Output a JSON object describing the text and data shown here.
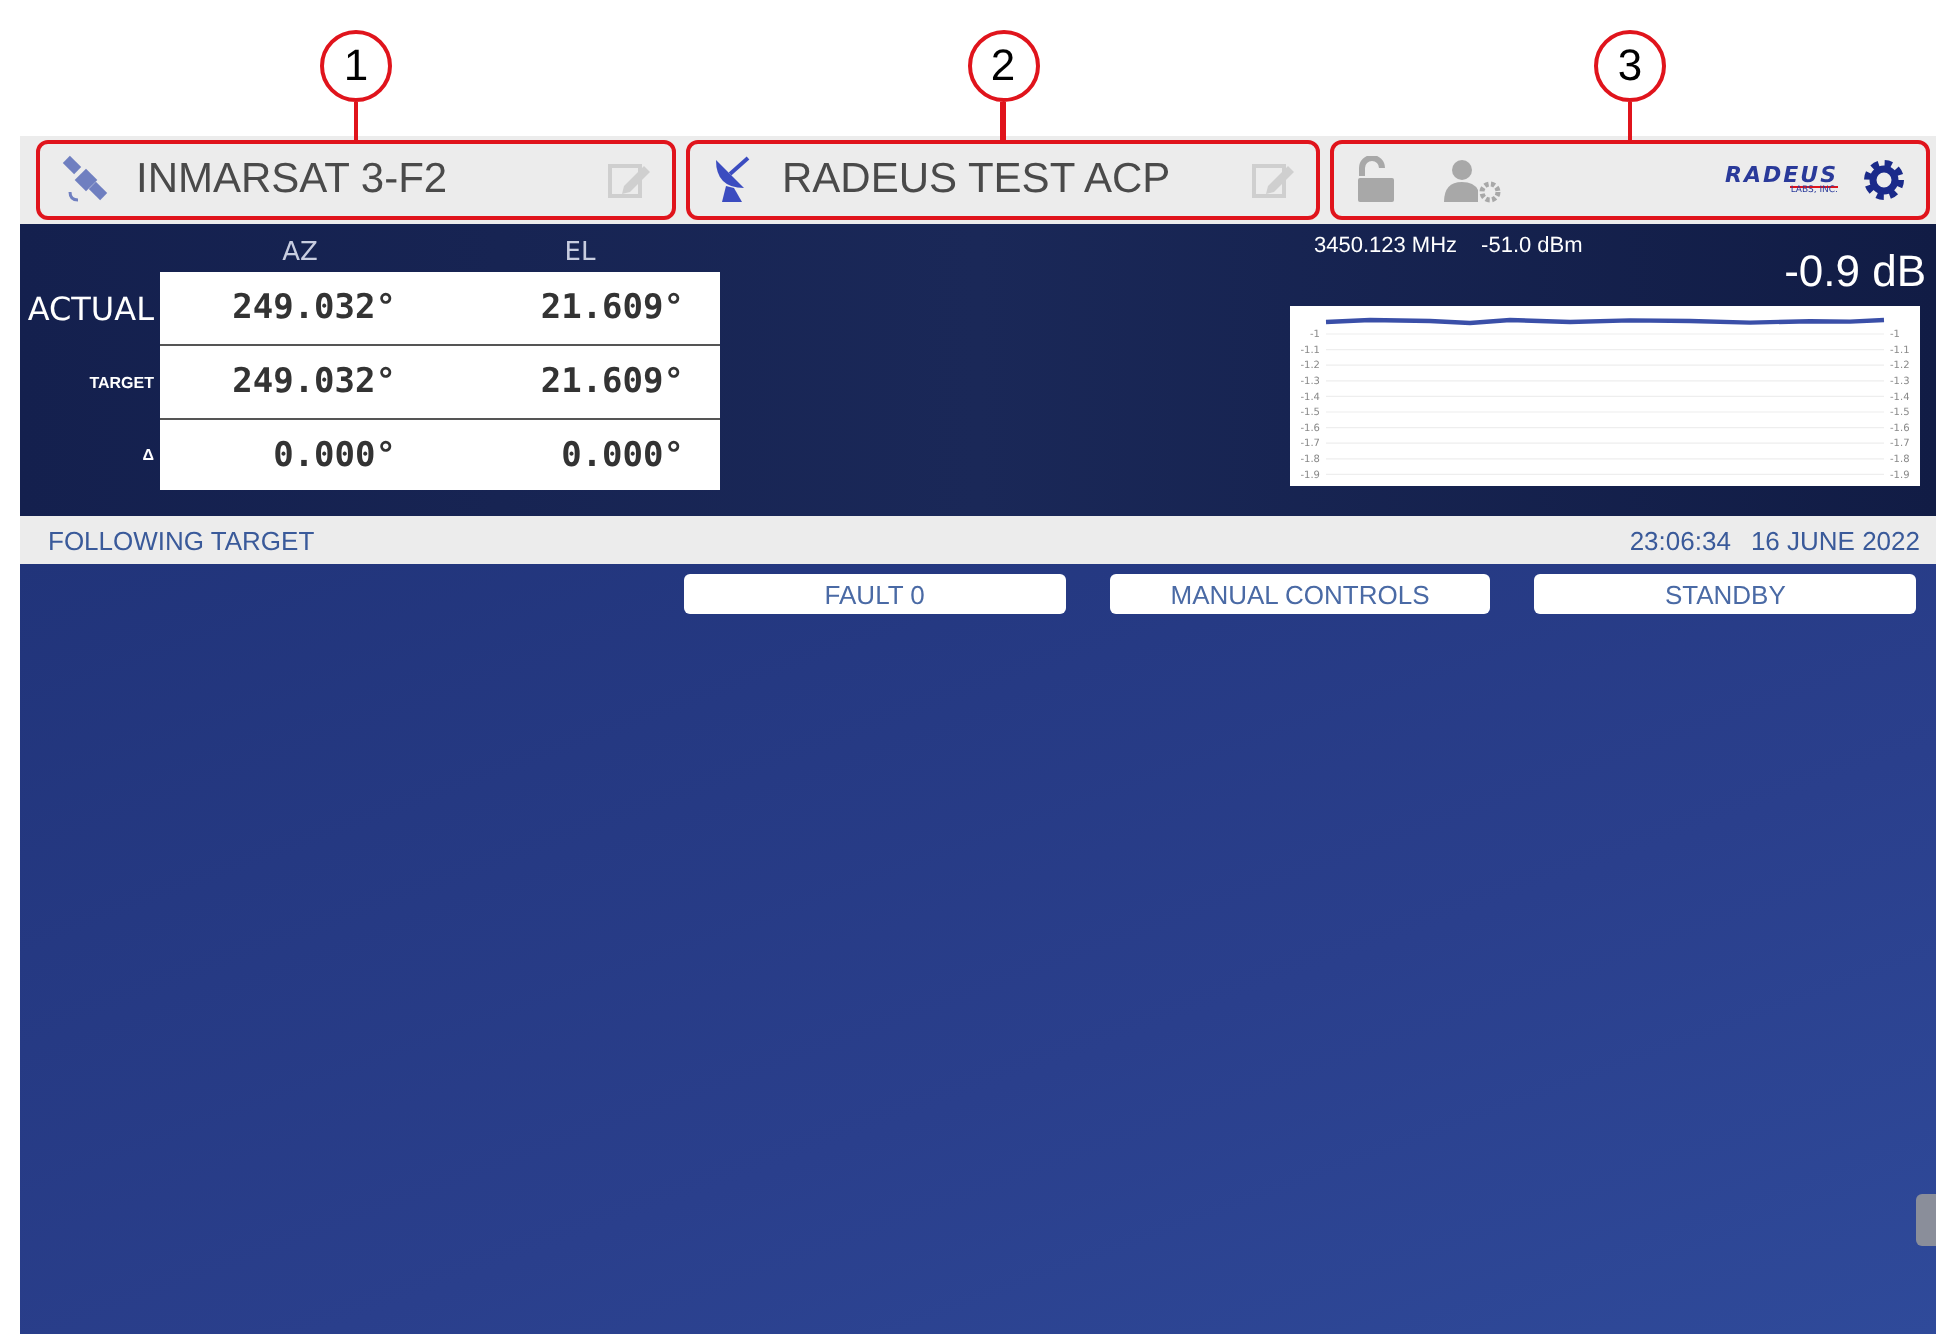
{
  "callouts": [
    {
      "number": "1"
    },
    {
      "number": "2"
    },
    {
      "number": "3"
    }
  ],
  "header": {
    "satellite": "INMARSAT 3-F2",
    "antenna": "RADEUS TEST ACP",
    "logo": {
      "name": "RADEUS",
      "tagline": "LABS, INC."
    }
  },
  "position": {
    "columns": [
      "AZ",
      "EL"
    ],
    "rows": [
      {
        "label": "ACTUAL",
        "kind": "large",
        "values": [
          "249.032°",
          "21.609°"
        ]
      },
      {
        "label": "TARGET",
        "kind": "small",
        "values": [
          "249.032°",
          "21.609°"
        ]
      },
      {
        "label": "Δ",
        "kind": "small",
        "values": [
          "0.000°",
          "0.000°"
        ]
      }
    ]
  },
  "signal": {
    "frequency": "3450.123 MHz",
    "power": "-51.0 dBm",
    "reading": "-0.9 dB",
    "trend": {
      "left_ticks": [
        "-1",
        "-1.1",
        "-1.2",
        "-1.3",
        "-1.4",
        "-1.5",
        "-1.6",
        "-1.7",
        "-1.8",
        "-1.9"
      ],
      "right_ticks": [
        "-1",
        "-1.1",
        "-1.2",
        "-1.3",
        "-1.4",
        "-1.5",
        "-1.6",
        "-1.7",
        "-1.8",
        "-1.9"
      ]
    }
  },
  "status_bar": {
    "state": "FOLLOWING TARGET",
    "time": "23:06:34",
    "date": "16 JUNE 2022"
  },
  "buttons": [
    "FAULT 0",
    "MANUAL CONTROLS",
    "STANDBY"
  ]
}
